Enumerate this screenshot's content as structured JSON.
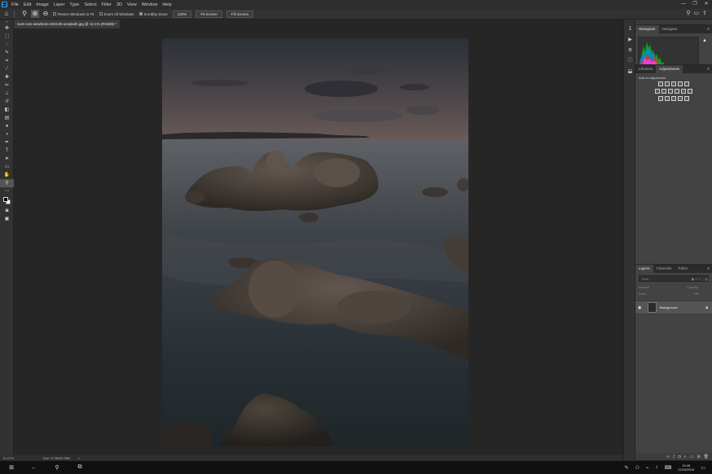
{
  "app": {
    "logo": "Ps"
  },
  "menu": [
    "File",
    "Edit",
    "Image",
    "Layer",
    "Type",
    "Select",
    "Filter",
    "3D",
    "View",
    "Window",
    "Help"
  ],
  "window_controls": {
    "minimize": "—",
    "restore": "❐",
    "close": "✕"
  },
  "options": {
    "resize_windows": "Resize Windows to Fit",
    "zoom_all": "Zoom All Windows",
    "scrubby": "Scrubby Zoom",
    "zoom_100": "100%",
    "fit_screen": "Fit Screen",
    "fill_screen": "Fill Screen"
  },
  "document_tab": "sven-van-wewheim-453135-unsplash.jpg @ 12.1% (RGB/8) *",
  "status": {
    "zoom": "12.27%",
    "doc": "Doc: 5.76M/5.76M",
    "arrow": ">"
  },
  "panels": {
    "histogram_tabs": [
      "Histogram",
      "Navigator"
    ],
    "adjust_tabs": [
      "Libraries",
      "Adjustments"
    ],
    "adjust_label": "Add an adjustment",
    "layers_tabs": [
      "Layers",
      "Channels",
      "Paths"
    ],
    "layers_search": "Kind",
    "blend_mode": "Normal",
    "opacity_label": "Opacity:",
    "lock_label": "Lock:",
    "fill_label": "Fill:",
    "layer_name": "Background"
  },
  "taskbar": {
    "time": "15:48",
    "date": "22/03/2019"
  },
  "colors": {
    "accent": "#31a8ff",
    "panel": "#434343",
    "workspace": "#262626"
  }
}
